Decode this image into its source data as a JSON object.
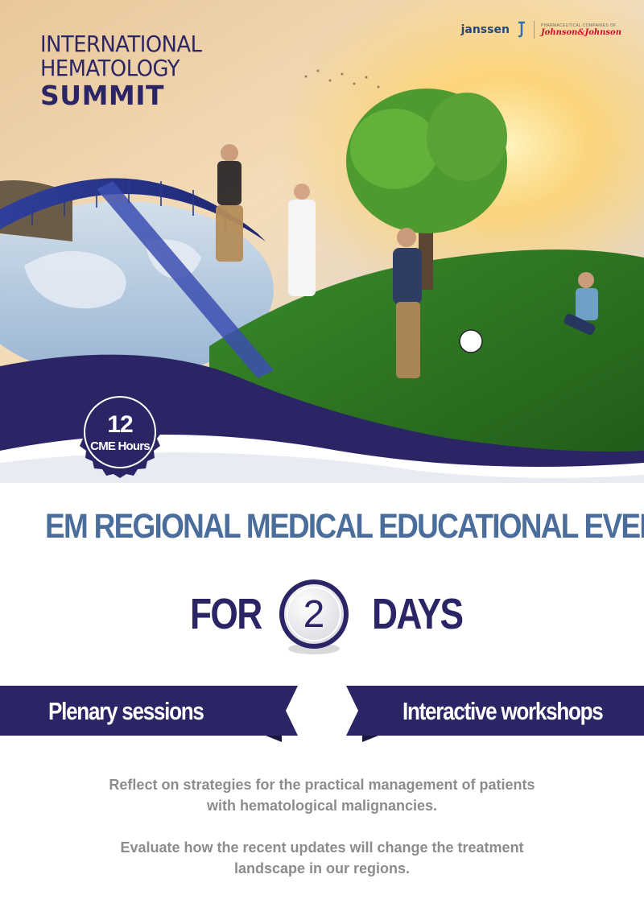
{
  "colors": {
    "navy": "#2b2566",
    "steel_blue": "#4a6d9c",
    "grey_text": "#8c8c8c",
    "jj_red": "#c8102e"
  },
  "brand": {
    "title_line1": "INTERNATIONAL",
    "title_line2": "HEMATOLOGY",
    "title_line3": "SUMMIT"
  },
  "logo": {
    "janssen": "janssen",
    "small_caption": "PHARMACEUTICAL COMPANIES OF",
    "jj": "Johnson&Johnson"
  },
  "badge": {
    "number": "12",
    "label": "CME Hours"
  },
  "headline": "EM REGIONAL MEDICAL EDUCATIONAL EVENT",
  "duration": {
    "prefix": "FOR",
    "number": "2",
    "suffix": "DAYS"
  },
  "ribbons": {
    "left": "Plenary sessions",
    "right": "Interactive workshops"
  },
  "paragraphs": [
    {
      "line1": "Reflect on strategies for the practical management of patients",
      "line2": "with hematological malignancies."
    },
    {
      "line1": "Evaluate how the recent updates will change the treatment",
      "line2": "landscape in our regions."
    }
  ]
}
